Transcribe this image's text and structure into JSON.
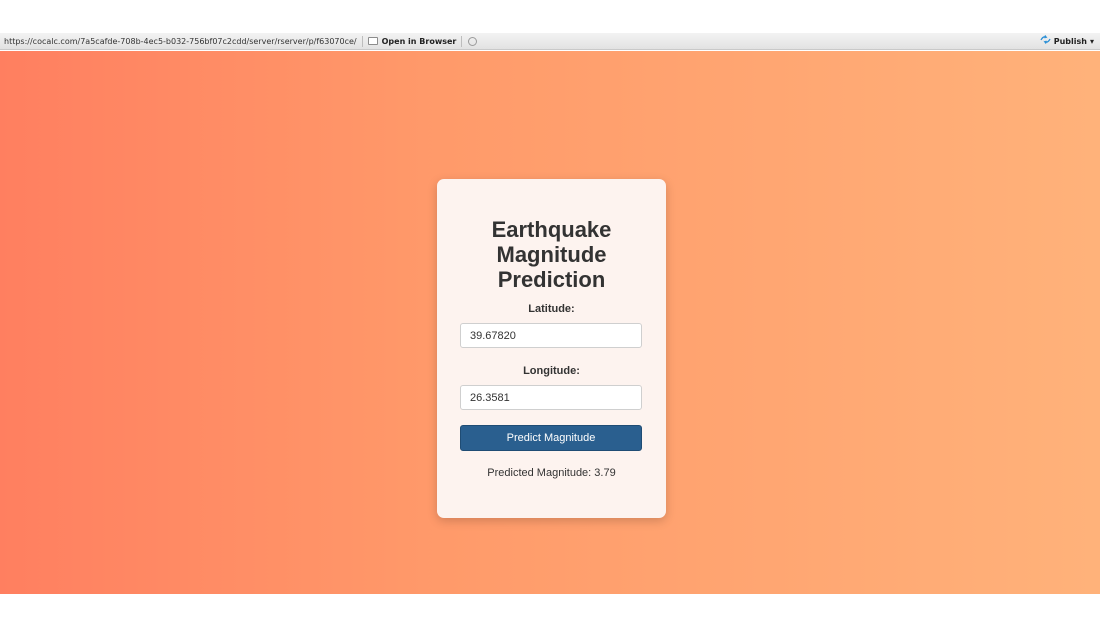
{
  "toolbar": {
    "url": "https://cocalc.com/7a5cafde-708b-4ec5-b032-756bf07c2cdd/server/rserver/p/f63070ce/",
    "open_in_browser_label": "Open in Browser",
    "publish_label": "Publish",
    "publish_icon": "publish-icon",
    "publish_caret": "▾"
  },
  "app": {
    "title_line1": "Earthquake",
    "title_line2": "Magnitude",
    "title_line3": "Prediction",
    "latitude_label": "Latitude:",
    "latitude_value": "39.67820",
    "longitude_label": "Longitude:",
    "longitude_value": "26.3581",
    "predict_button_label": "Predict Magnitude",
    "result_text": "Predicted Magnitude: 3.79"
  },
  "colors": {
    "background_left": "#ff7f60",
    "background_right": "#ffb27a",
    "card_background": "#fdf3ef",
    "button_background": "#2a5f8f"
  }
}
